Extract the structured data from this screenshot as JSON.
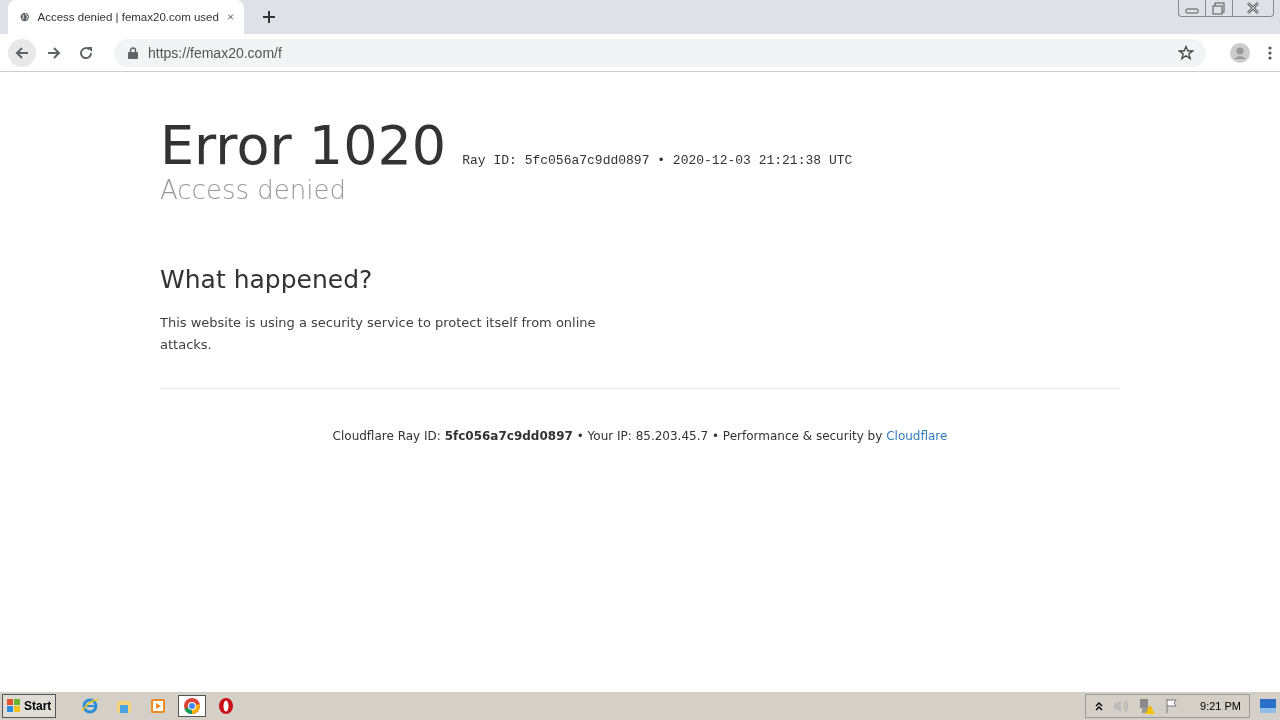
{
  "tabs": [
    {
      "title": "Access denied | femax20.com used",
      "selected": true
    }
  ],
  "address_bar": {
    "url": "https://femax20.com/f"
  },
  "page": {
    "error_title": "Error 1020",
    "ray_line": "Ray ID: 5fc056a7c9dd0897 • 2020-12-03 21:21:38 UTC",
    "subtitle": "Access denied",
    "section_title": "What happened?",
    "section_text": "This website is using a security service to protect itself from online attacks.",
    "footer": {
      "text": "Cloudflare Ray ID: **5fc056a7c9dd0897** • Your IP: 85.203.45.7 • Performance & security by",
      "link": "Cloudflare"
    }
  },
  "taskbar": {
    "start": "Start",
    "apps": [
      {
        "kind": "ie",
        "selected": false
      },
      {
        "kind": "folder",
        "selected": false
      },
      {
        "kind": "media",
        "selected": false
      },
      {
        "kind": "chrome",
        "selected": true
      },
      {
        "kind": "opera",
        "selected": false
      }
    ],
    "clock": "9:21 PM"
  }
}
